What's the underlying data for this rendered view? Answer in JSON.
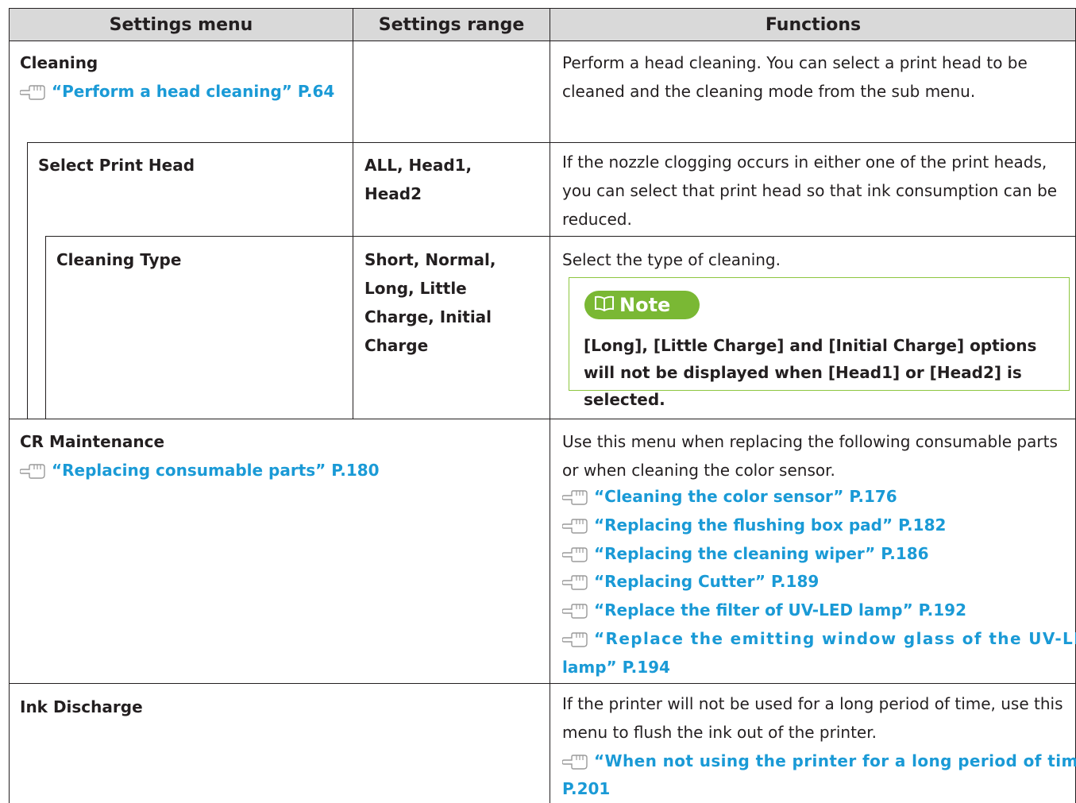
{
  "header": {
    "col_menu": "Settings menu",
    "col_range": "Settings range",
    "col_functions": "Functions"
  },
  "rows": {
    "cleaning": {
      "menu": "Cleaning",
      "ref": "“Perform a head cleaning” P.64",
      "range": "",
      "function": "Perform a head cleaning. You can select a print head to be cleaned and the cleaning mode from the sub menu."
    },
    "select_print_head": {
      "menu": "Select Print Head",
      "range_line1": "ALL, Head1,",
      "range_line2": "Head2",
      "function": "If the nozzle clogging occurs in either one of the print heads, you can select that print head so that ink consumption can be reduced."
    },
    "cleaning_type": {
      "menu": "Cleaning Type",
      "range_lines": [
        "Short, Normal,",
        "Long, Little",
        "Charge, Initial",
        "Charge"
      ],
      "function": "Select the type of cleaning.",
      "note_label": "Note",
      "note_text": "[Long], [Little Charge] and [Initial Charge] options will not be displayed when [Head1] or [Head2] is selected."
    },
    "cr_maintenance": {
      "menu": "CR Maintenance",
      "ref": "“Replacing consumable parts” P.180",
      "function": "Use this menu when replacing the following consumable parts or when cleaning the color sensor.",
      "refs": [
        "“Cleaning the color sensor” P.176",
        "“Replacing the flushing box pad” P.182",
        "“Replacing the cleaning wiper” P.186",
        "“Replacing Cutter” P.189",
        "“Replace the filter of UV-LED lamp” P.192"
      ],
      "ref_long_line1": "“Replace the emitting window glass of the UV-LED",
      "ref_long_line2": "lamp” P.194"
    },
    "ink_discharge": {
      "menu": "Ink Discharge",
      "function": "If the printer will not be used for a long period of time, use this menu to flush the ink out of the printer.",
      "ref_line1": "“When not using the printer for a long period of time”",
      "ref_line2": "P.201"
    }
  },
  "icon": "pointing-hand-reference-icon",
  "colors": {
    "link": "#1a9ad6",
    "note_green": "#7ab834",
    "header_bg": "#d9d9d9"
  }
}
